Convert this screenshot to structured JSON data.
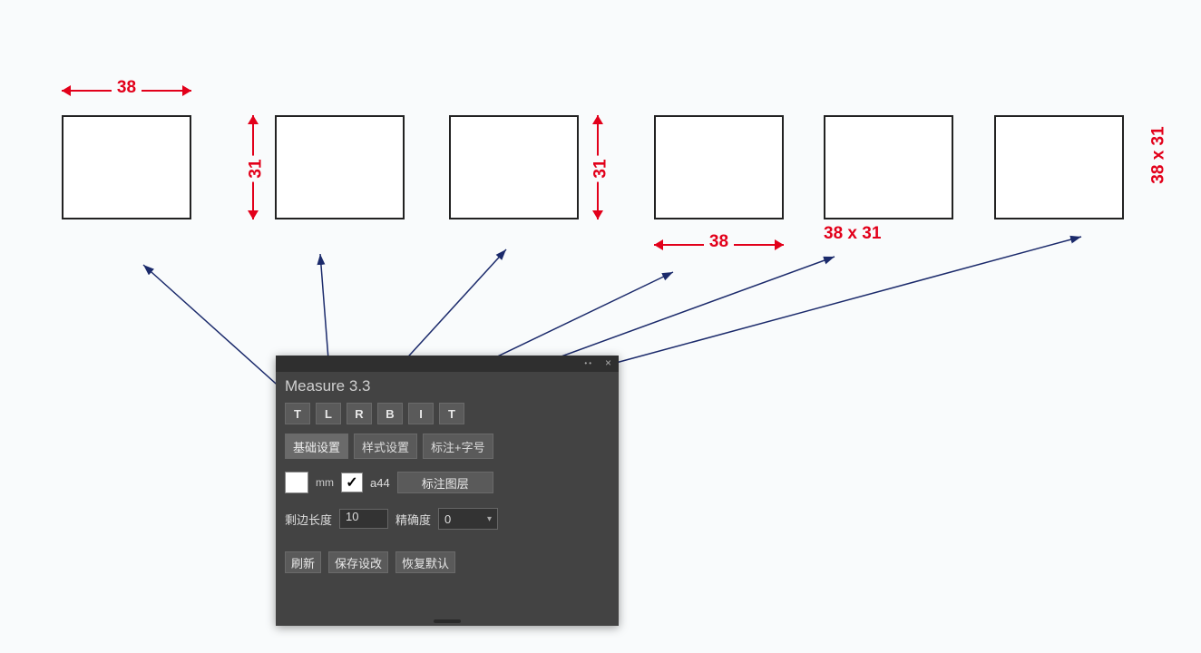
{
  "dims": {
    "top_width": "38",
    "left2_height": "31",
    "right3_height": "31",
    "bottom4_width": "38",
    "label5": "38 x 31",
    "label6": "38 x 31"
  },
  "panel": {
    "title": "Measure 3.3",
    "buttons": {
      "b1": "T",
      "b2": "L",
      "b3": "R",
      "b4": "B",
      "b5": "I",
      "b6": "T"
    },
    "tabs": {
      "t1": "基础设置",
      "t2": "样式设置",
      "t3": "标注+字号"
    },
    "unit": "mm",
    "pt_label": "a44",
    "layer_btn": "标注图层",
    "offset_label": "剩边长度",
    "offset_value": "10",
    "precision_label": "精确度",
    "precision_value": "0",
    "btn_refresh": "刷新",
    "btn_save": "保存设改",
    "btn_reset": "恢复默认"
  }
}
